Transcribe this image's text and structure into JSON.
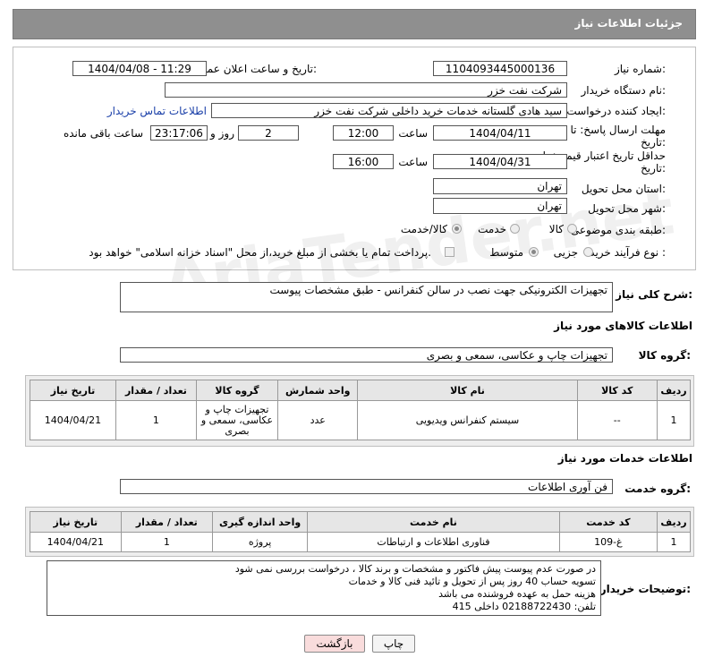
{
  "header": {
    "title": "جزئیات اطلاعات نیاز"
  },
  "form": {
    "need_number_label": "شماره نیاز:",
    "need_number": "1104093445000136",
    "announce_label": "تاریخ و ساعت اعلان عمومی:",
    "announce_value": "1404/04/08 - 11:29",
    "buyer_label": "نام دستگاه خریدار:",
    "buyer_value": "شرکت نفت خزر",
    "requester_label": "ایجاد کننده درخواست:",
    "requester_value": "سید هادی گلستانه خدمات خرید داخلی شرکت نفت خزر",
    "contact_link": "اطلاعات تماس خریدار",
    "deadline_label": "مهلت ارسال پاسخ: تا تاریخ:",
    "deadline_date": "1404/04/11",
    "time_label": "ساعت",
    "deadline_time": "12:00",
    "days_value": "2",
    "days_label": "روز و",
    "remaining_time": "23:17:06",
    "remaining_label": "ساعت باقی مانده",
    "price_valid_label": "حداقل تاریخ اعتبار قیمت: تا تاریخ:",
    "price_valid_date": "1404/04/31",
    "price_valid_time": "16:00",
    "province_label": "استان محل تحویل:",
    "province_value": "تهران",
    "city_label": "شهر محل تحویل:",
    "city_value": "تهران",
    "category_label": "طبقه بندی موضوعی:",
    "category_options": [
      "کالا",
      "خدمت",
      "کالا/خدمت"
    ],
    "process_label": "نوع فرآیند خرید :",
    "process_options": [
      "جزیی",
      "متوسط"
    ],
    "payment_text": "پرداخت تمام یا بخشی از مبلغ خرید،از محل \"اسناد خزانه اسلامی\" خواهد بود."
  },
  "summary": {
    "label": "شرح کلی نیاز:",
    "value": "تجهیزات الکترونیکی جهت نصب در سالن کنفرانس - طبق مشخصات پیوست"
  },
  "goods": {
    "title": "اطلاعات کالاهای مورد نیاز",
    "group_label": "گروه کالا:",
    "group_value": "تجهیزات چاپ و عکاسی، سمعی و بصری",
    "columns": [
      "ردیف",
      "کد کالا",
      "نام کالا",
      "واحد شمارش",
      "گروه کالا",
      "تعداد / مقدار",
      "تاریخ نیاز"
    ],
    "rows": [
      {
        "row": "1",
        "code": "--",
        "name": "سیستم کنفرانس ویدیویی",
        "unit": "عدد",
        "group": "تجهیزات چاپ و عکاسی، سمعی و بصری",
        "qty": "1",
        "date": "1404/04/21"
      }
    ]
  },
  "services": {
    "title": "اطلاعات خدمات مورد نیاز",
    "group_label": "گروه خدمت:",
    "group_value": "فن آوری اطلاعات",
    "columns": [
      "ردیف",
      "کد خدمت",
      "نام خدمت",
      "واحد اندازه گیری",
      "تعداد / مقدار",
      "تاریخ نیاز"
    ],
    "rows": [
      {
        "row": "1",
        "code": "غ-109",
        "name": "فناوری اطلاعات و ارتباطات",
        "unit": "پروژه",
        "qty": "1",
        "date": "1404/04/21"
      }
    ]
  },
  "buyer_notes": {
    "label": "توضیحات خریدار:",
    "lines": [
      "در صورت عدم پیوست پیش فاکتور و مشخصات و برند کالا ، درخواست بررسی نمی شود",
      "تسویه حساب 40 روز پس از تحویل و تائید فنی کالا و خدمات",
      "هزینه حمل به عهده فروشنده می باشد",
      "تلفن: 02188722430 داخلی 415"
    ]
  },
  "buttons": {
    "print": "چاپ",
    "back": "بازگشت"
  },
  "watermark": "AriaTender.net"
}
